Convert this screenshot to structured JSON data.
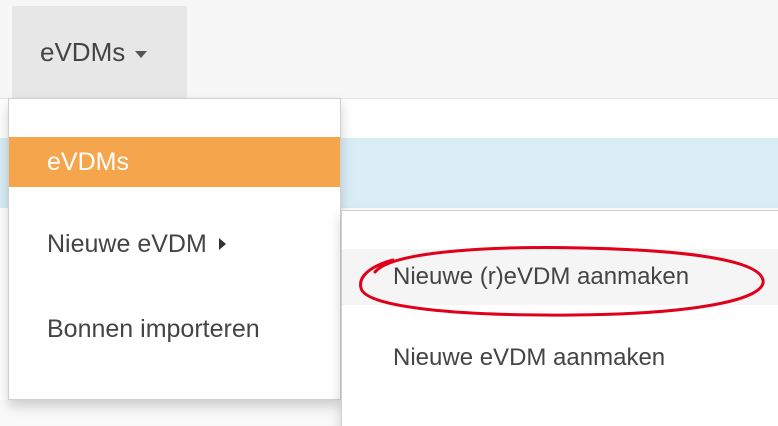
{
  "navbar": {
    "toggle_label": "eVDMs"
  },
  "dropdown": {
    "items": [
      {
        "label": "eVDMs"
      },
      {
        "label": "Nieuwe eVDM"
      },
      {
        "label": "Bonnen importeren"
      }
    ]
  },
  "submenu": {
    "items": [
      {
        "label": "Nieuwe (r)eVDM aanmaken"
      },
      {
        "label": "Nieuwe eVDM aanmaken"
      }
    ]
  },
  "colors": {
    "active_item": "#f5a54c",
    "highlight_oval": "#e0001a",
    "alert_strip": "#d9edf7"
  },
  "icons": {
    "toggle_caret": "caret-down-icon",
    "submenu_caret": "caret-right-icon"
  }
}
